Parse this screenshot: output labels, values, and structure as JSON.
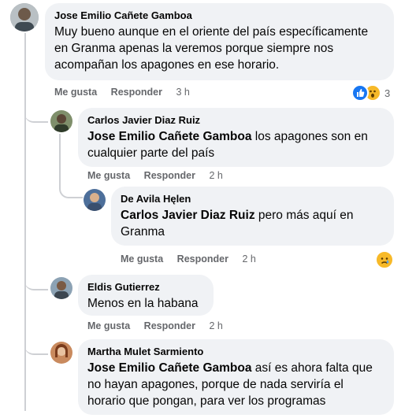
{
  "comments": [
    {
      "author": "Jose Emilio Cañete Gamboa",
      "mention": "",
      "text": "Muy bueno aunque en el oriente del país específicamente en Granma apenas la veremos porque siempre nos acompañan los apagones en ese horario.",
      "like_label": "Me gusta",
      "reply_label": "Responder",
      "time": "3 h",
      "reaction_count": "3"
    },
    {
      "author": "Carlos Javier Diaz Ruiz",
      "mention": "Jose Emilio Cañete Gamboa",
      "text": " los apagones son en cualquier parte del país",
      "like_label": "Me gusta",
      "reply_label": "Responder",
      "time": "2 h"
    },
    {
      "author": "De Avila Hęlen",
      "mention": "Carlos Javier Diaz Ruiz",
      "text": " pero más aquí en Granma",
      "like_label": "Me gusta",
      "reply_label": "Responder",
      "time": "2 h"
    },
    {
      "author": "Eldis Gutierrez",
      "mention": "",
      "text": "Menos en la habana",
      "like_label": "Me gusta",
      "reply_label": "Responder",
      "time": "2 h"
    },
    {
      "author": "Martha Mulet Sarmiento",
      "mention": "Jose Emilio Cañete Gamboa",
      "text": " así es ahora falta que no hayan apagones, porque de nada serviría el horario que pongan, para ver los programas",
      "like_label": "",
      "reply_label": "",
      "time": ""
    }
  ],
  "icons": {
    "like": "like-reaction-icon",
    "wow": "wow-reaction-icon",
    "sad": "sad-reaction-icon"
  },
  "colors": {
    "bubble": "#f0f2f5",
    "meta_text": "#65676b",
    "like_blue": "#1877f2",
    "emoji_yellow": "#f7b928"
  }
}
